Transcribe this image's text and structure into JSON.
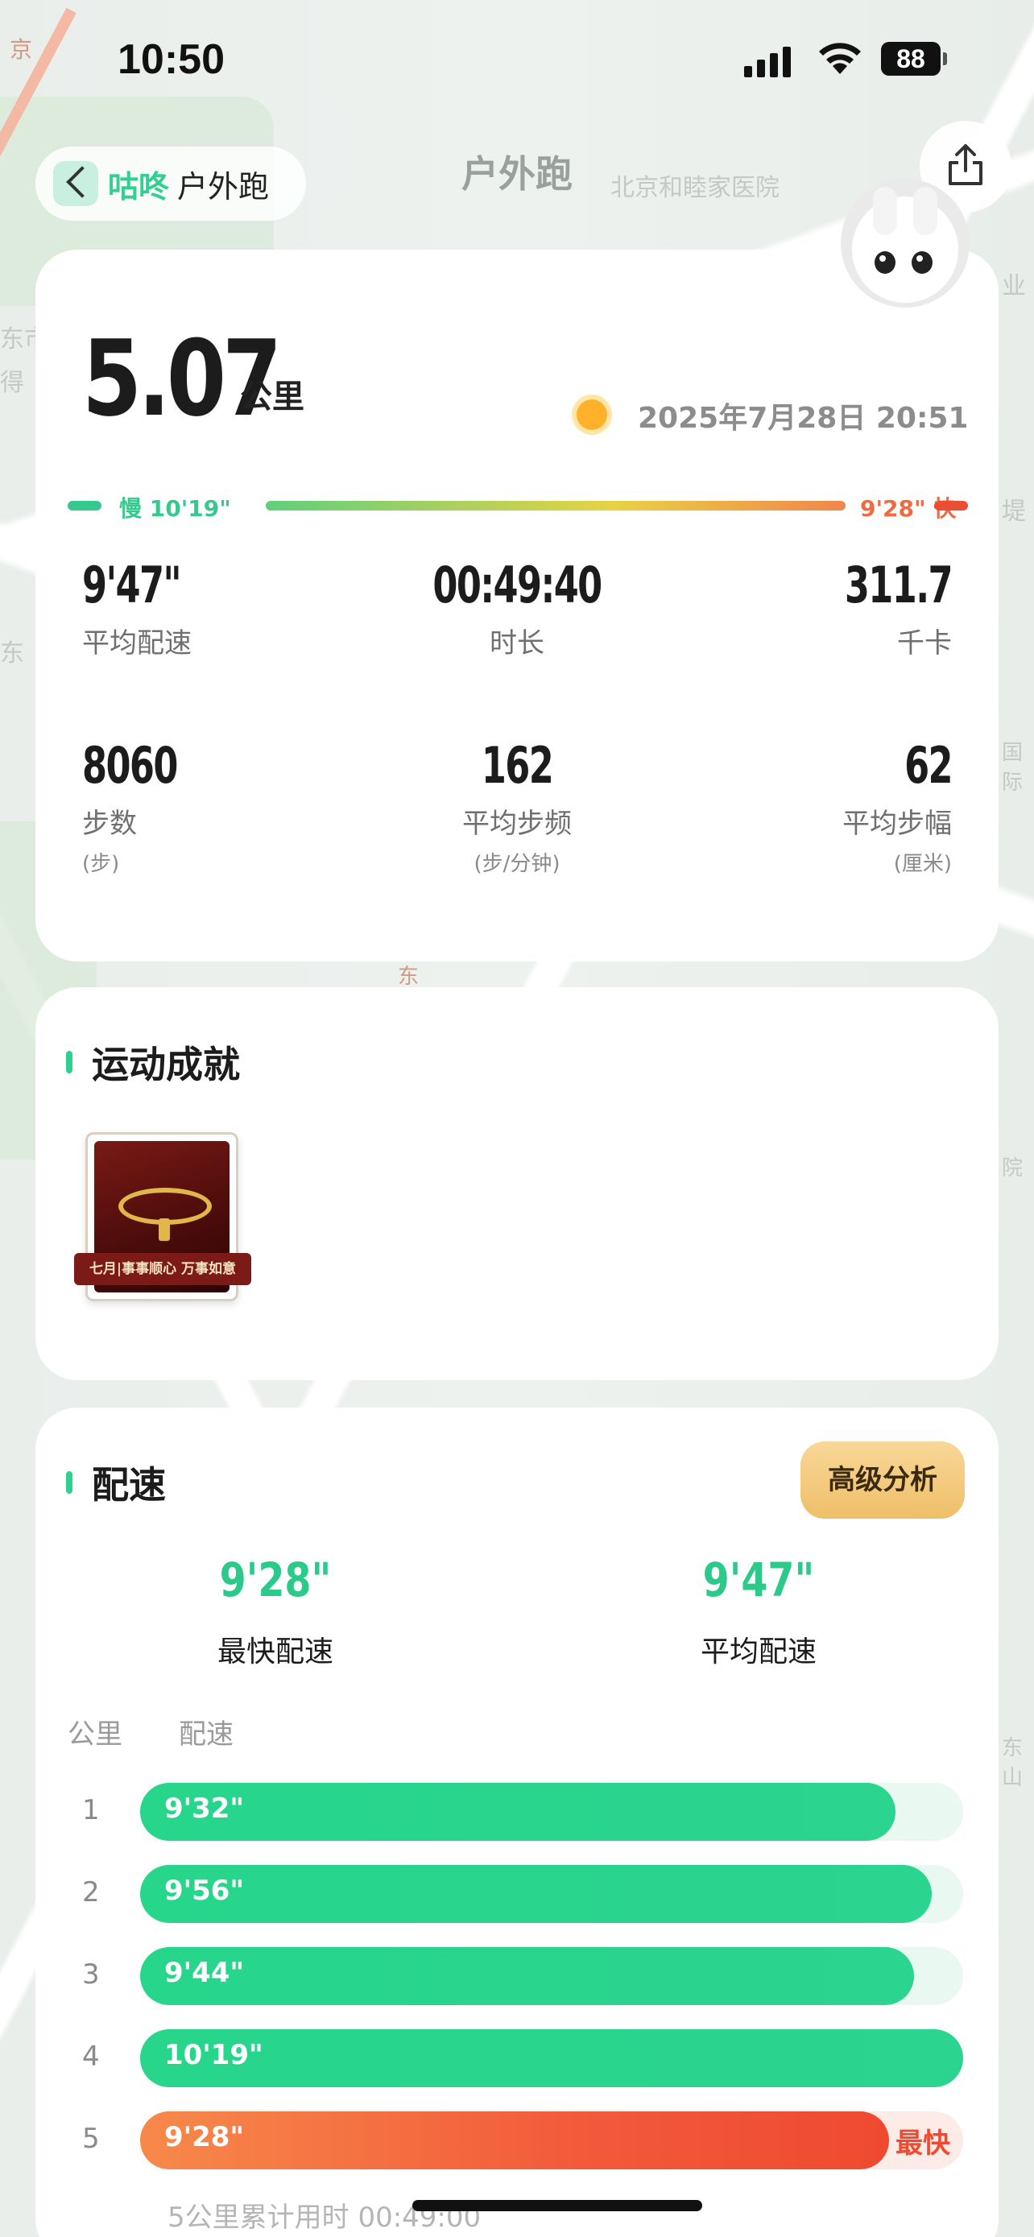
{
  "status_bar": {
    "time": "10:50",
    "battery": "88"
  },
  "nav": {
    "brand": "咕咚",
    "brand_sub": "户外跑",
    "title": "户外跑"
  },
  "map": {
    "labels": [
      "北京和睦家医院",
      "东市",
      "得",
      "业",
      "堤",
      "国际",
      "东",
      "院",
      "东山",
      "东",
      "京"
    ]
  },
  "summary": {
    "distance": "5.07",
    "distance_unit": "公里",
    "date": "2025年7月28日 20:51",
    "pace_range": {
      "slow_label": "慢 10'19\"",
      "fast_label": "9'28\" 快"
    },
    "stats": [
      {
        "value": "9'47\"",
        "label": "平均配速",
        "sub": ""
      },
      {
        "value": "00:49:40",
        "label": "时长",
        "sub": ""
      },
      {
        "value": "311.7",
        "label": "千卡",
        "sub": ""
      },
      {
        "value": "8060",
        "label": "步数",
        "sub": "(步)"
      },
      {
        "value": "162",
        "label": "平均步频",
        "sub": "(步/分钟)"
      },
      {
        "value": "62",
        "label": "平均步幅",
        "sub": "(厘米)"
      }
    ]
  },
  "achievements": {
    "title": "运动成就",
    "medal_caption": "七月|事事顺心 万事如意"
  },
  "pace": {
    "title": "配速",
    "advanced_button": "高级分析",
    "fastest_value": "9'28\"",
    "fastest_label": "最快配速",
    "average_value": "9'47\"",
    "average_label": "平均配速",
    "col_km": "公里",
    "col_pace": "配速",
    "splits": [
      {
        "km": "1",
        "pace": "9'32\"",
        "ratio": 0.918,
        "tag": ""
      },
      {
        "km": "2",
        "pace": "9'56\"",
        "ratio": 0.962,
        "tag": ""
      },
      {
        "km": "3",
        "pace": "9'44\"",
        "ratio": 0.94,
        "tag": ""
      },
      {
        "km": "4",
        "pace": "10'19\"",
        "ratio": 1.0,
        "tag": ""
      },
      {
        "km": "5",
        "pace": "9'28\"",
        "ratio": 0.91,
        "tag": "最快",
        "fastest": true
      }
    ],
    "cumulative": "5公里累计用时 00:49:00"
  }
}
